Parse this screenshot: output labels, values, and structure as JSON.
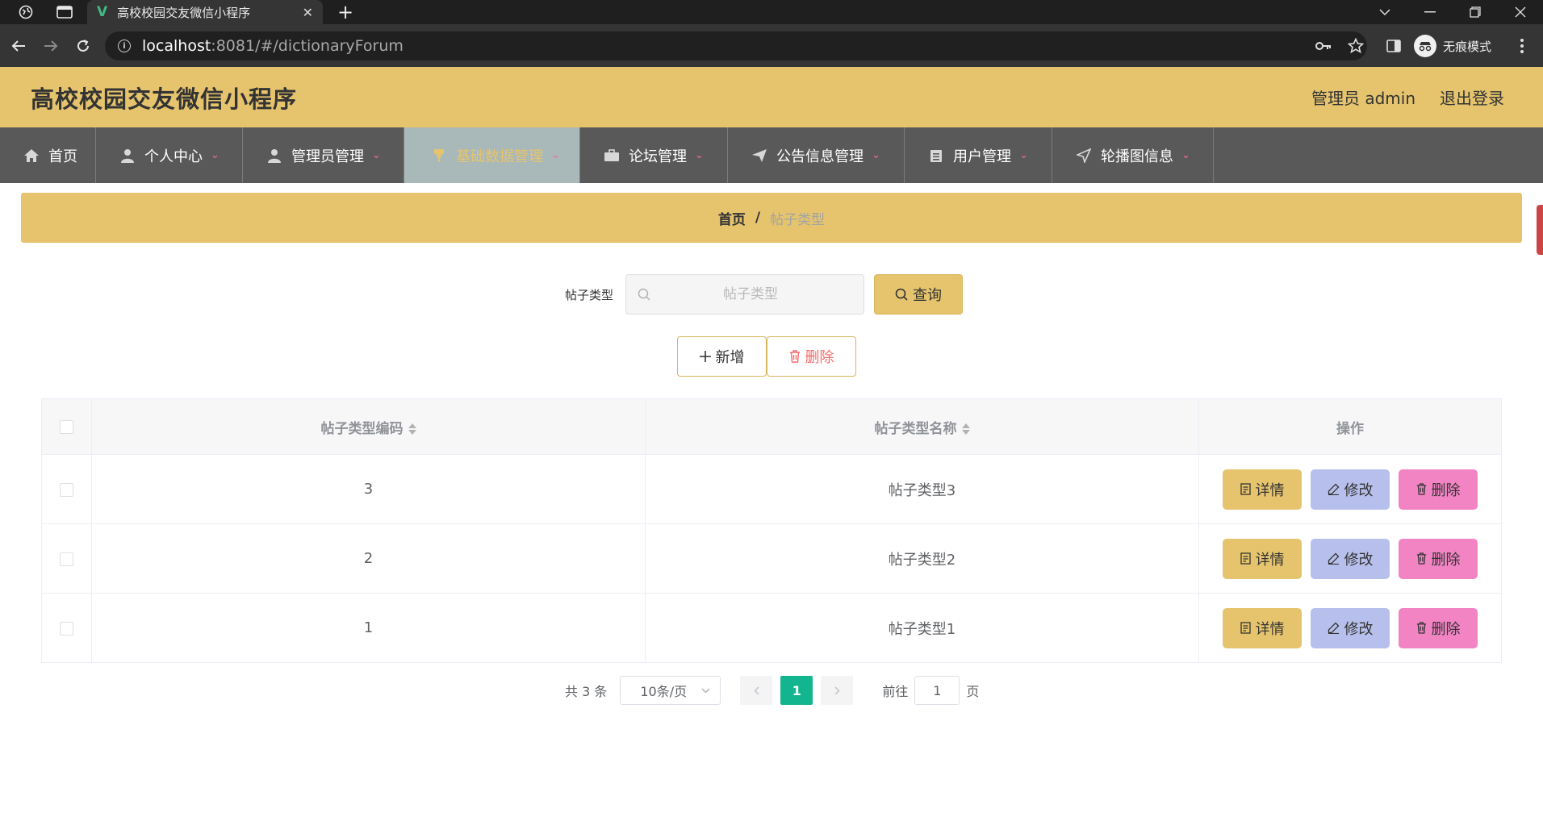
{
  "browser": {
    "tab_title": "高校校园交友微信小程序",
    "url_host": "localhost",
    "url_path": ":8081/#/dictionaryForum",
    "incognito_label": "无痕模式",
    "icons": [
      "globe-icon",
      "tab-page-icon",
      "vue-logo-icon",
      "close-icon",
      "plus-icon",
      "back-icon",
      "forward-icon",
      "reload-icon",
      "info-icon",
      "key-icon",
      "star-icon",
      "sidebar-icon",
      "incognito-icon",
      "kebab-menu-icon"
    ]
  },
  "header": {
    "title": "高校校园交友微信小程序",
    "user": "管理员 admin",
    "logout": "退出登录"
  },
  "menu": {
    "items": [
      {
        "label": "首页",
        "icon": "home-icon"
      },
      {
        "label": "个人中心",
        "icon": "user-icon"
      },
      {
        "label": "管理员管理",
        "icon": "user-icon"
      },
      {
        "label": "基础数据管理",
        "icon": "pin-icon"
      },
      {
        "label": "论坛管理",
        "icon": "briefcase-icon"
      },
      {
        "label": "公告信息管理",
        "icon": "send-icon"
      },
      {
        "label": "用户管理",
        "icon": "clipboard-icon"
      },
      {
        "label": "轮播图信息",
        "icon": "navigation-icon"
      }
    ],
    "active_index": 3
  },
  "breadcrumb": {
    "home": "首页",
    "separator": "/",
    "current": "帖子类型"
  },
  "search": {
    "label": "帖子类型",
    "placeholder": "帖子类型",
    "button": "查询"
  },
  "actions": {
    "add": "新增",
    "delete": "删除"
  },
  "table": {
    "columns": [
      "帖子类型编码",
      "帖子类型名称",
      "操作"
    ],
    "rows": [
      {
        "code": "3",
        "name": "帖子类型3"
      },
      {
        "code": "2",
        "name": "帖子类型2"
      },
      {
        "code": "1",
        "name": "帖子类型1"
      }
    ],
    "row_actions": {
      "detail": "详情",
      "edit": "修改",
      "delete": "删除"
    }
  },
  "pagination": {
    "total": "共 3 条",
    "page_size": "10条/页",
    "current_page": "1",
    "goto_prefix": "前往",
    "goto_value": "1",
    "goto_suffix": "页"
  },
  "colors": {
    "accent": "#e6c46e",
    "menu_bg": "#595959",
    "active_page": "#13b58e",
    "edit_button": "#b7c0ec",
    "delete_button": "#f284c4"
  }
}
